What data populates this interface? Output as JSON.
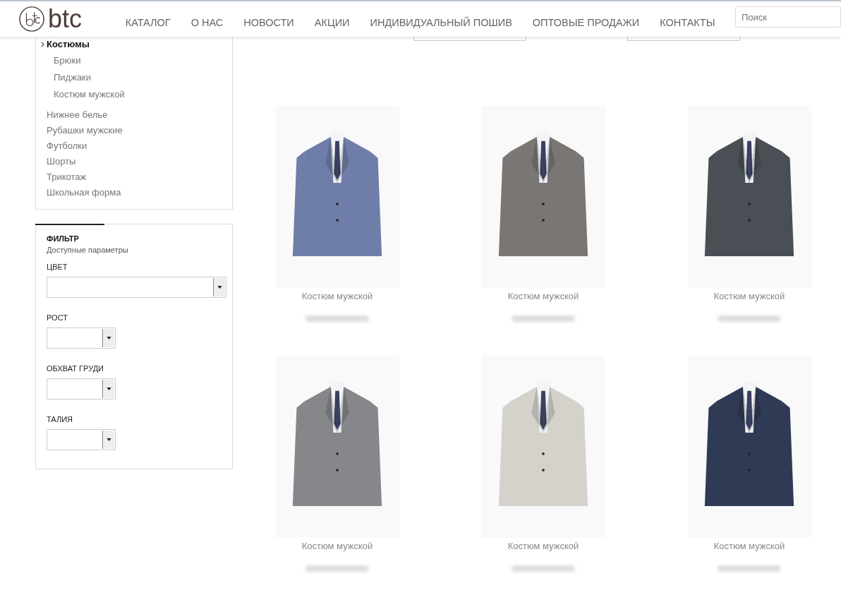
{
  "header": {
    "logo": "btc",
    "nav": [
      "КАТАЛОГ",
      "О НАС",
      "НОВОСТИ",
      "АКЦИИ",
      "ИНДИВИДУАЛЬНЫЙ ПОШИВ",
      "ОПТОВЫЕ ПРОДАЖИ",
      "КОНТАКТЫ"
    ],
    "search": {
      "placeholder": "Поиск"
    }
  },
  "categories": [
    {
      "label": "Костюмы",
      "selected": true,
      "children": [
        {
          "label": "Брюки",
          "selected": false
        },
        {
          "label": "Пиджаки",
          "selected": false
        },
        {
          "label": "Костюм мужской",
          "selected": false
        }
      ]
    },
    {
      "label": "Нижнее белье",
      "selected": false
    },
    {
      "label": "Рубашки мужские",
      "selected": false
    },
    {
      "label": "Футболки",
      "selected": false
    },
    {
      "label": "Шорты",
      "selected": false
    },
    {
      "label": "Трикотаж",
      "selected": false
    },
    {
      "label": "Школьная форма",
      "selected": false
    }
  ],
  "filter": {
    "title": "ФИЛЬТР",
    "subtitle": "Доступные параметры",
    "fields": [
      {
        "label": "ЦВЕТ",
        "kind": "wide"
      },
      {
        "label": "РОСТ",
        "kind": "narrow"
      },
      {
        "label": "ОБХВАТ ГРУДИ",
        "kind": "narrow"
      },
      {
        "label": "ТАЛИЯ",
        "kind": "narrow"
      }
    ]
  },
  "products": [
    {
      "name": "Костюм мужской",
      "color": "#6f7ea8"
    },
    {
      "name": "Костюм мужской",
      "color": "#7a7674"
    },
    {
      "name": "Костюм мужской",
      "color": "#4a4f55"
    },
    {
      "name": "Костюм мужской",
      "color": "#85878a"
    },
    {
      "name": "Костюм мужской",
      "color": "#d4d2cb"
    },
    {
      "name": "Костюм мужской",
      "color": "#2f3a55"
    }
  ]
}
